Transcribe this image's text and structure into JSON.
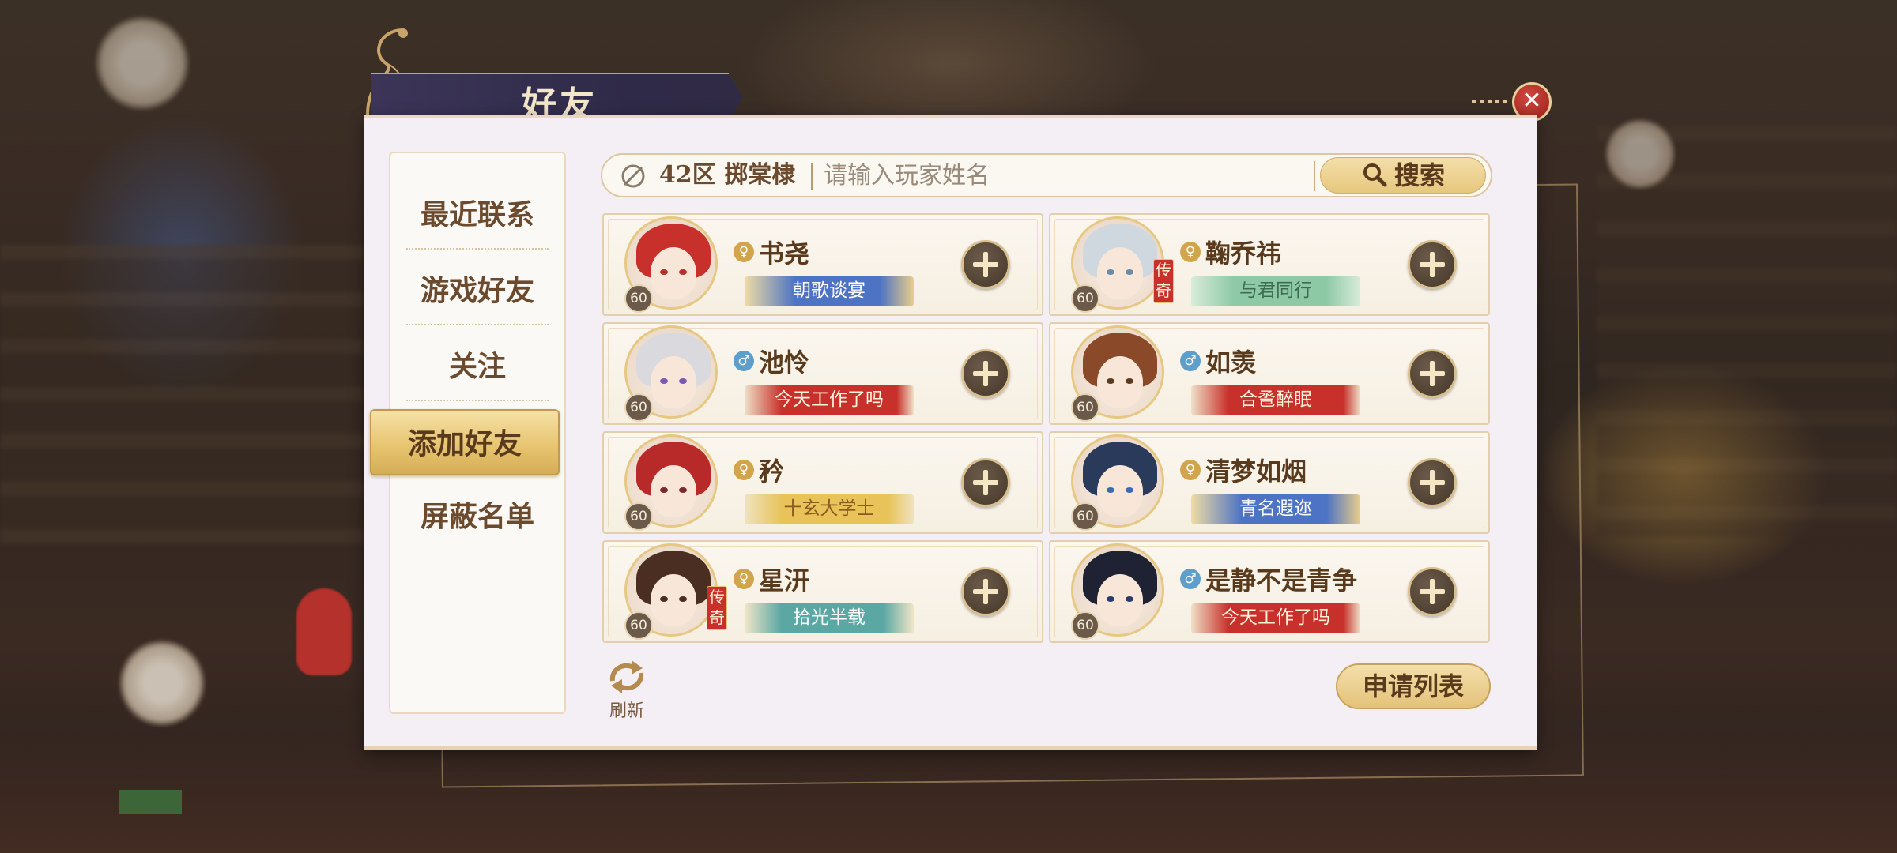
{
  "window": {
    "title": "好友",
    "close_label": "✕"
  },
  "sidebar": {
    "items": [
      {
        "label": "最近联系",
        "active": false
      },
      {
        "label": "游戏好友",
        "active": false
      },
      {
        "label": "关注",
        "active": false
      },
      {
        "label": "添加好友",
        "active": true
      },
      {
        "label": "屏蔽名单",
        "active": false
      }
    ]
  },
  "search": {
    "server": "42区 掷棠棣",
    "placeholder": "请输入玩家姓名",
    "value": "",
    "button_label": "搜索"
  },
  "players": [
    {
      "name": "书尧",
      "gender": "female",
      "gender_symbol": "♀",
      "level": "60",
      "title": "朝歌谈宴",
      "title_color": "blue",
      "legend": "",
      "hair_color": "#c8312b",
      "eye_color": "#b5312b"
    },
    {
      "name": "鞠乔祎",
      "gender": "female",
      "gender_symbol": "♀",
      "level": "60",
      "title": "与君同行",
      "title_color": "green",
      "legend": "传奇",
      "hair_color": "#cfd8de",
      "eye_color": "#6a8aa8"
    },
    {
      "name": "池怜",
      "gender": "male",
      "gender_symbol": "♂",
      "level": "60",
      "title": "今天工作了吗",
      "title_color": "red",
      "legend": "",
      "hair_color": "#d9d9de",
      "eye_color": "#7a5ab0"
    },
    {
      "name": "如羡",
      "gender": "male",
      "gender_symbol": "♂",
      "level": "60",
      "title": "合卺醉眠",
      "title_color": "red",
      "legend": "",
      "hair_color": "#8a4a2a",
      "eye_color": "#5a3a1c"
    },
    {
      "name": "矜",
      "gender": "female",
      "gender_symbol": "♀",
      "level": "60",
      "title": "十玄大学士",
      "title_color": "gold",
      "legend": "",
      "hair_color": "#b82a2a",
      "eye_color": "#7a2a2a"
    },
    {
      "name": "清梦如烟",
      "gender": "female",
      "gender_symbol": "♀",
      "level": "60",
      "title": "青名遐迩",
      "title_color": "blue",
      "legend": "",
      "hair_color": "#2a3a5a",
      "eye_color": "#3a6ab0"
    },
    {
      "name": "星汧",
      "gender": "female",
      "gender_symbol": "♀",
      "level": "60",
      "title": "拾光半载",
      "title_color": "teal",
      "legend": "传奇",
      "hair_color": "#4a2e22",
      "eye_color": "#4a2e22"
    },
    {
      "name": "是静不是青争",
      "gender": "male",
      "gender_symbol": "♂",
      "level": "60",
      "title": "今天工作了吗",
      "title_color": "red",
      "legend": "",
      "hair_color": "#1e2233",
      "eye_color": "#2a3a6a"
    }
  ],
  "footer": {
    "refresh_label": "刷新",
    "apply_list_label": "申请列表"
  },
  "colors": {
    "accent_gold": "#e6c77e",
    "brand_red": "#c8312b",
    "panel_bg": "#f3eff4",
    "text_brown": "#5a3a1c"
  }
}
